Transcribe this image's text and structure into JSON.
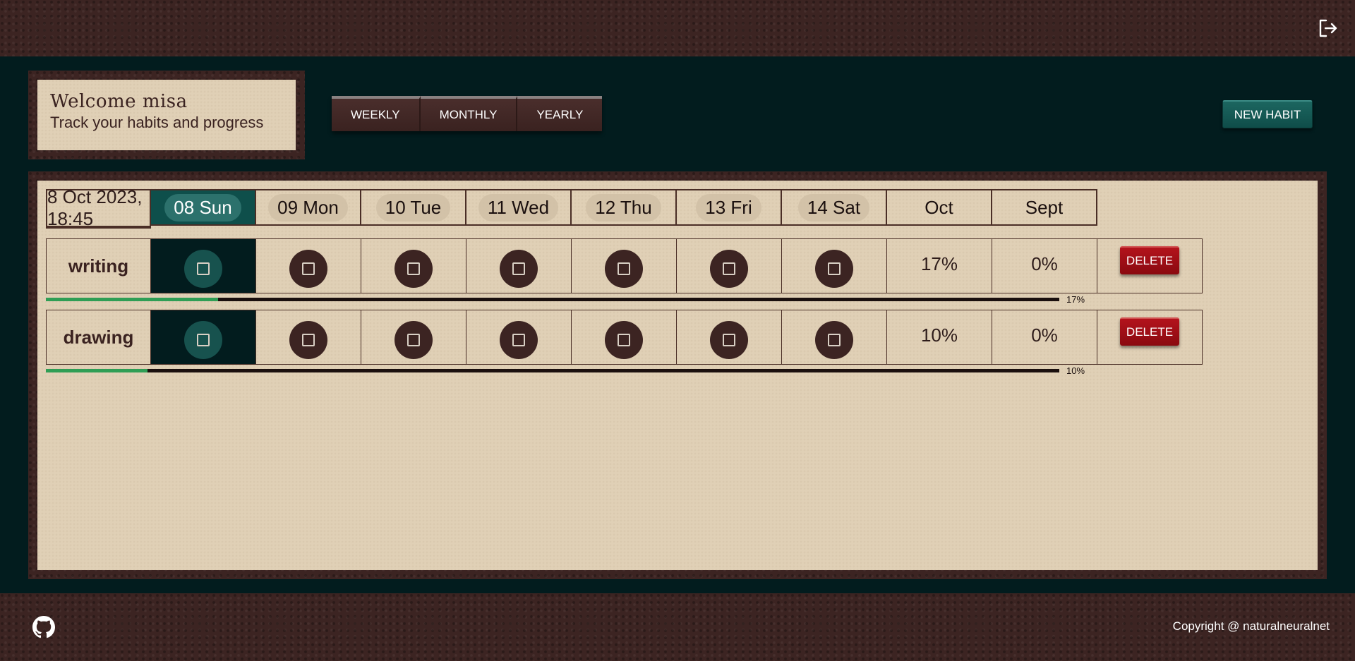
{
  "header": {
    "logout_icon": "logout-icon"
  },
  "welcome": {
    "title": "Welcome misa",
    "subtitle": "Track your habits and progress"
  },
  "views": [
    {
      "label": "WEEKLY"
    },
    {
      "label": "MONTHLY"
    },
    {
      "label": "YEARLY"
    }
  ],
  "new_habit_label": "NEW HABIT",
  "board": {
    "datetime": "8 Oct 2023, 18:45",
    "days": [
      "08 Sun",
      "09 Mon",
      "10 Tue",
      "11 Wed",
      "12 Thu",
      "13 Fri",
      "14 Sat"
    ],
    "today_index": 0,
    "months": [
      "Oct",
      "Sept"
    ]
  },
  "habits": [
    {
      "name": "writing",
      "oct": "17%",
      "sept": "0%",
      "delete_label": "DELETE",
      "progress": 0.17,
      "progress_label": "17%"
    },
    {
      "name": "drawing",
      "oct": "10%",
      "sept": "0%",
      "delete_label": "DELETE",
      "progress": 0.1,
      "progress_label": "10%"
    }
  ],
  "footer": {
    "github_icon": "github-icon",
    "copyright": "Copyright @ naturalneuralnet"
  },
  "colors": {
    "leather": "#3c2422",
    "background": "#021c1e",
    "paper": "#e0d0b6",
    "accent_teal": "#0e4f4b",
    "delete_red": "#b3131c",
    "progress_green": "#2f9e55"
  }
}
